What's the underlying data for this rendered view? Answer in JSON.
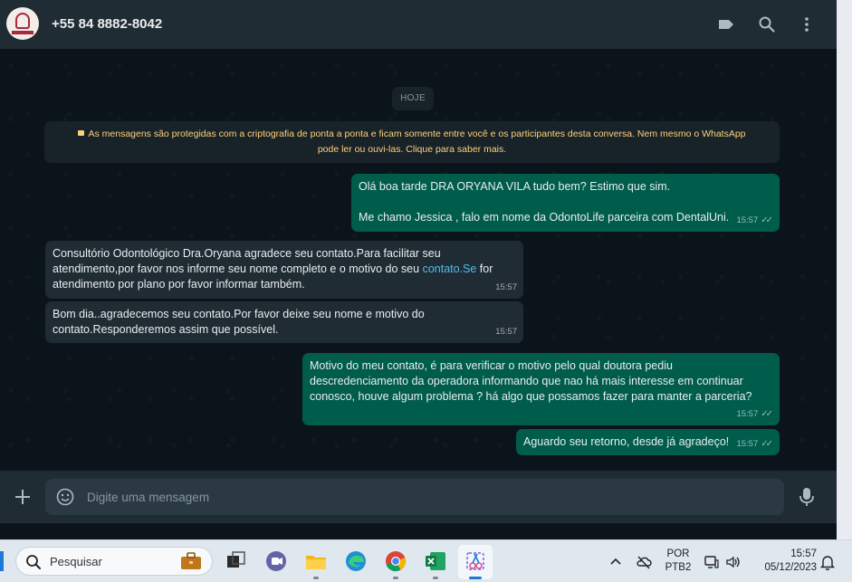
{
  "header": {
    "contact": "+55 84 8882-8042",
    "icons": [
      "label-icon",
      "search-icon",
      "menu-icon"
    ]
  },
  "chat": {
    "day_separator": "HOJE",
    "encryption_notice": {
      "line1": "As mensagens são protegidas com a criptografia de ponta a ponta e ficam somente entre você e os participantes desta conversa. Nem mesmo o WhatsApp",
      "line2": "pode ler ou ouvi-las. Clique para saber mais."
    },
    "messages": [
      {
        "direction": "out",
        "lines": [
          "Olá boa tarde DRA ORYANA VILA  tudo bem? Estimo que sim.",
          "",
          "Me chamo Jessica , falo em nome da OdontoLife parceira com DentalUni."
        ],
        "time": "15:57"
      },
      {
        "direction": "in",
        "line1": "Consultório Odontológico Dra.Oryana agradece seu contato.Para facilitar seu",
        "line2_start": "atendimento,por favor nos informe seu nome completo e o motivo do seu ",
        "line2_link": "contato.Se",
        "line2_end": " for",
        "line3": "atendimento por plano por favor informar também.",
        "time": "15:57"
      },
      {
        "direction": "in",
        "lines": [
          "Bom dia..agradecemos seu contato.Por favor deixe seu nome e motivo do",
          "contato.Responderemos assim que possível."
        ],
        "time": "15:57"
      },
      {
        "direction": "out",
        "lines": [
          "Motivo do meu contato, é para verificar o motivo pelo qual doutora pediu",
          "descredenciamento da operadora informando que nao há mais interesse em continuar",
          "conosco, houve algum problema ? há algo que possamos fazer para manter a parceria?"
        ],
        "time": "15:57"
      },
      {
        "direction": "out",
        "lines": [
          "Aguardo seu retorno, desde já agradeço!"
        ],
        "time": "15:57"
      }
    ]
  },
  "composer": {
    "placeholder": "Digite uma mensagem"
  },
  "taskbar": {
    "search_label": "Pesquisar",
    "apps": [
      "briefcase-icon",
      "task-view-icon",
      "teams-icon",
      "file-explorer-icon",
      "edge-icon",
      "chrome-icon",
      "excel-icon",
      "snipping-tool-icon"
    ],
    "language_top": "POR",
    "language_bottom": "PTB2",
    "time": "15:57",
    "date": "05/12/2023"
  },
  "colors": {
    "outgoing_bubble": "#005c4b",
    "incoming_bubble": "#202c33",
    "notice_text": "#ffd279",
    "link": "#53bdeb"
  }
}
